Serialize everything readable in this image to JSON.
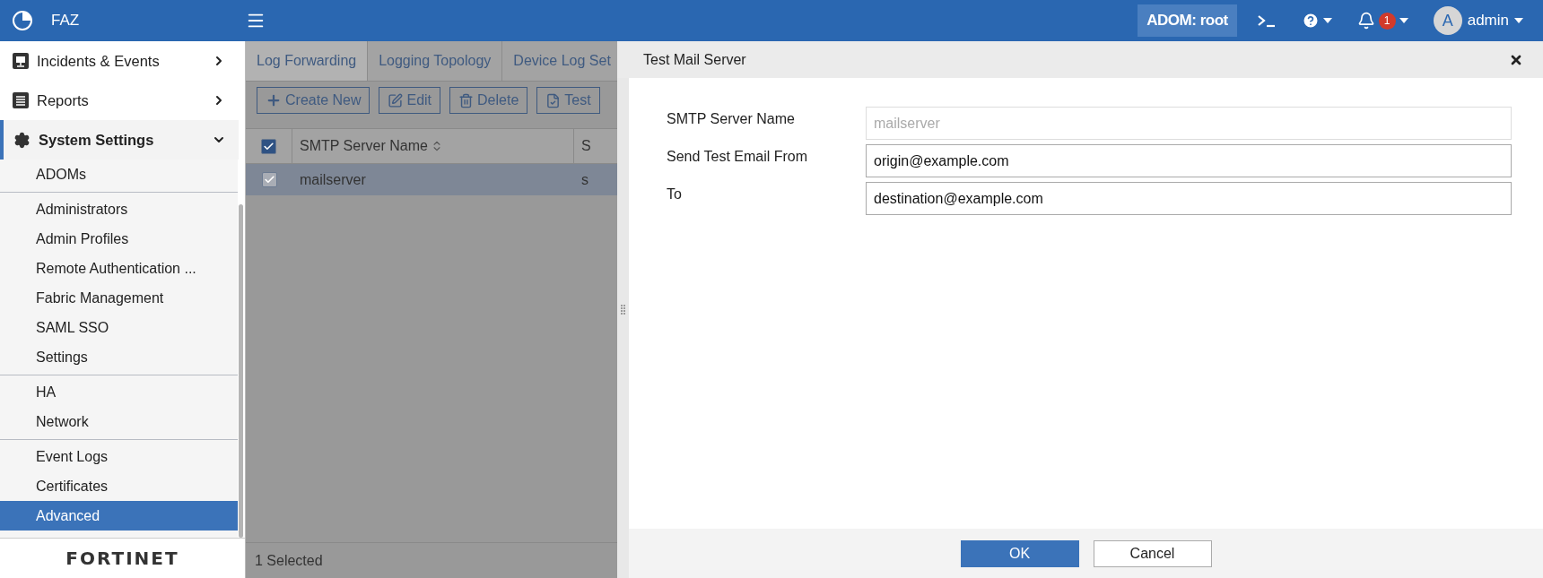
{
  "header": {
    "app_name": "FAZ",
    "adom": "ADOM: root",
    "notification_count": "1",
    "user_initial": "A",
    "user_name": "admin"
  },
  "sidebar": {
    "items": [
      {
        "label": "Incidents & Events",
        "expanded": false
      },
      {
        "label": "Reports",
        "expanded": false
      },
      {
        "label": "System Settings",
        "expanded": true,
        "groups": [
          {
            "items": [
              {
                "label": "ADOMs",
                "selected": false
              }
            ]
          },
          {
            "items": [
              {
                "label": "Administrators",
                "selected": false
              },
              {
                "label": "Admin Profiles",
                "selected": false
              },
              {
                "label": "Remote Authentication ...",
                "selected": false
              },
              {
                "label": "Fabric Management",
                "selected": false
              },
              {
                "label": "SAML SSO",
                "selected": false
              },
              {
                "label": "Settings",
                "selected": false
              }
            ]
          },
          {
            "items": [
              {
                "label": "HA",
                "selected": false
              },
              {
                "label": "Network",
                "selected": false
              }
            ]
          },
          {
            "items": [
              {
                "label": "Event Logs",
                "selected": false
              },
              {
                "label": "Certificates",
                "selected": false
              },
              {
                "label": "Advanced",
                "selected": true
              }
            ]
          }
        ]
      }
    ],
    "logo_text": "FORTINET"
  },
  "tabs": [
    {
      "label": "Log Forwarding",
      "selected": true
    },
    {
      "label": "Logging Topology",
      "selected": false
    },
    {
      "label": "Device Log Set",
      "selected": false
    }
  ],
  "toolbar": [
    {
      "label": "Create New"
    },
    {
      "label": "Edit"
    },
    {
      "label": "Delete"
    },
    {
      "label": "Test"
    }
  ],
  "table": {
    "all_checked": true,
    "columns": [
      {
        "label": "SMTP Server Name",
        "sortable": true
      },
      {
        "label": "S",
        "sortable": false
      }
    ],
    "rows": [
      {
        "cells": [
          "mailserver",
          "s"
        ],
        "selected": true,
        "checked": true
      }
    ]
  },
  "status_bar": "1 Selected",
  "dialog": {
    "title": "Test Mail Server",
    "fields": [
      {
        "label": "SMTP Server Name",
        "value": "mailserver",
        "disabled": true
      },
      {
        "label": "Send Test Email From",
        "value": "origin@example.com",
        "disabled": false
      },
      {
        "label": "To",
        "value": "destination@example.com",
        "disabled": false
      }
    ],
    "buttons": [
      {
        "label": "OK",
        "kind": "primary"
      },
      {
        "label": "Cancel",
        "kind": "secondary"
      }
    ]
  }
}
